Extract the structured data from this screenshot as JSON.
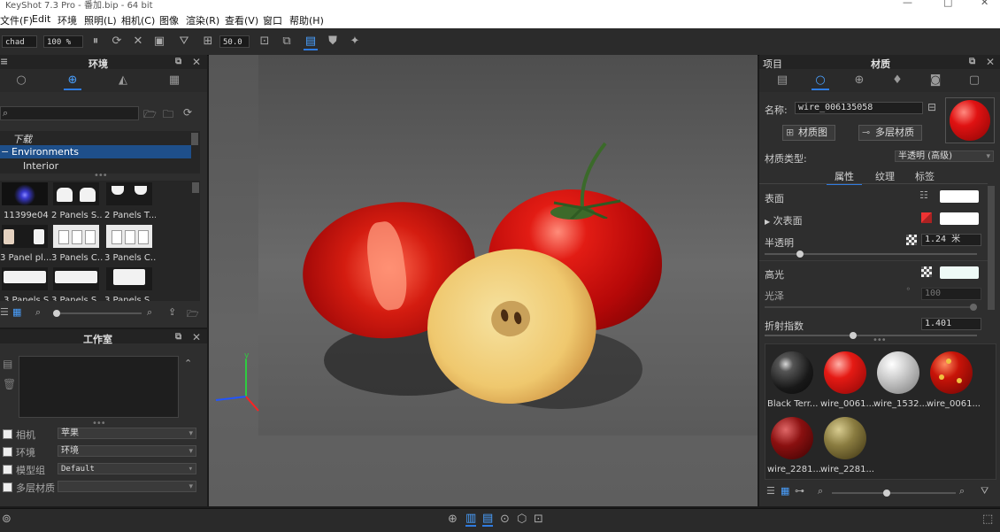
{
  "titlebar": {
    "title": "KeyShot 7.3 Pro - 番加.bip - 64 bit",
    "min": "—",
    "max": "□",
    "close": "✕"
  },
  "menu": [
    {
      "label": "文件(F)"
    },
    {
      "label": "Edit"
    },
    {
      "label": "环境"
    },
    {
      "label": "照明(L)"
    },
    {
      "label": "相机(C)"
    },
    {
      "label": "图像"
    },
    {
      "label": "渲染(R)"
    },
    {
      "label": "查看(V)"
    },
    {
      "label": "窗口"
    },
    {
      "label": "帮助(H)"
    }
  ],
  "toolbar": {
    "preset": "chad",
    "zoom": "100 %",
    "fov": "50.0"
  },
  "env_panel": {
    "title": "环境",
    "tree": [
      {
        "label": "下载"
      },
      {
        "label": "Environments"
      },
      {
        "label": "Interior"
      }
    ],
    "thumbs": [
      {
        "label": "11399e04"
      },
      {
        "label": "2 Panels S..."
      },
      {
        "label": "2 Panels T..."
      },
      {
        "label": "3 Panel pl..."
      },
      {
        "label": "3 Panels C..."
      },
      {
        "label": "3 Panels C..."
      },
      {
        "label": "3 Panels S..."
      },
      {
        "label": "3 Panels S..."
      },
      {
        "label": "3 Panels S..."
      }
    ]
  },
  "studio_panel": {
    "title": "工作室",
    "rows": [
      {
        "label": "相机",
        "value": "苹果"
      },
      {
        "label": "环境",
        "value": "环境"
      },
      {
        "label": "模型组",
        "value": "Default"
      },
      {
        "label": "多层材质",
        "value": ""
      }
    ]
  },
  "mat_panel": {
    "project_label": "项目",
    "title": "材质",
    "name_label": "名称:",
    "name_value": "wire_006135058",
    "graph_btn": "材质图",
    "multi_btn": "多层材质",
    "type_label": "材质类型:",
    "type_value": "半透明 (高级)",
    "tabs": [
      {
        "label": "属性"
      },
      {
        "label": "纹理"
      },
      {
        "label": "标签"
      }
    ],
    "props": {
      "surface": "表面",
      "subsurface": "次表面",
      "translucency": "半透明",
      "translucency_value": "1.24 米",
      "specular": "高光",
      "gloss": "光泽",
      "gloss_value": "100",
      "ior": "折射指数",
      "ior_value": "1.401"
    },
    "library": [
      {
        "label": "Black Terr..."
      },
      {
        "label": "wire_0061..."
      },
      {
        "label": "wire_1532..."
      },
      {
        "label": "wire_0061..."
      },
      {
        "label": "wire_2281..."
      },
      {
        "label": "wire_2281..."
      }
    ]
  },
  "colors": {
    "accent": "#2f7be0",
    "panel": "#2e2e2e",
    "viewport": "#595959"
  }
}
